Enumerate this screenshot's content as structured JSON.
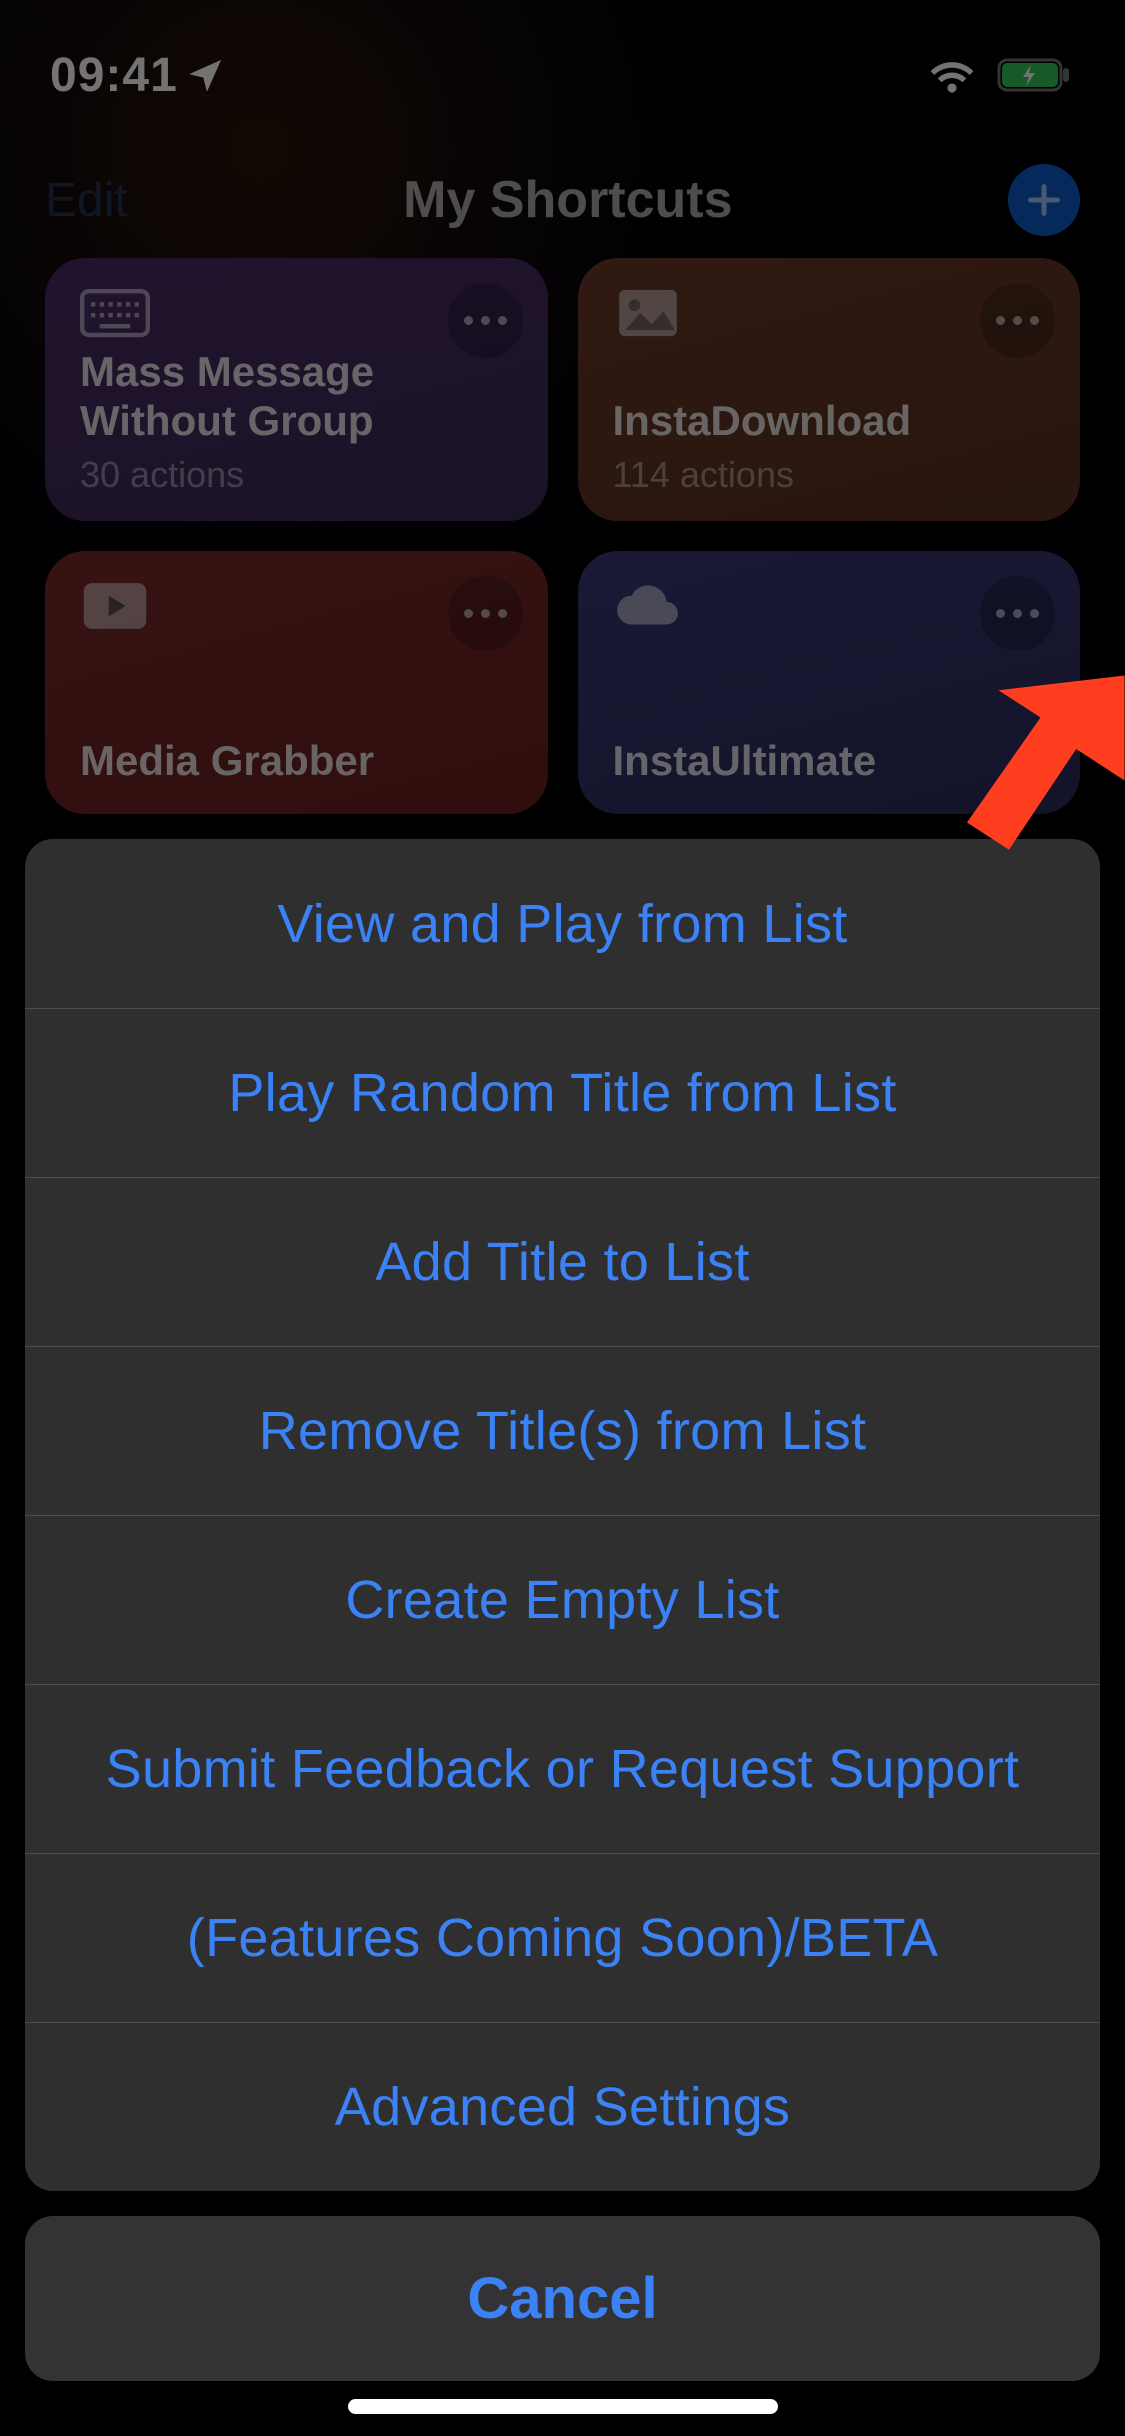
{
  "status": {
    "time": "09:41"
  },
  "nav": {
    "edit": "Edit",
    "title": "My Shortcuts"
  },
  "cards": [
    {
      "title": "Mass Message Without Group",
      "sub": "30 actions"
    },
    {
      "title": "InstaDownload",
      "sub": "114 actions"
    },
    {
      "title": "Media Grabber",
      "sub": ""
    },
    {
      "title": "InstaUltimate",
      "sub": ""
    }
  ],
  "sheet": {
    "items": [
      "View and Play from List",
      "Play Random Title from List",
      "Add Title to List",
      "Remove Title(s) from List",
      "Create Empty List",
      "Submit Feedback or Request Support",
      "(Features Coming Soon)/BETA",
      "Advanced Settings"
    ],
    "cancel": "Cancel"
  }
}
